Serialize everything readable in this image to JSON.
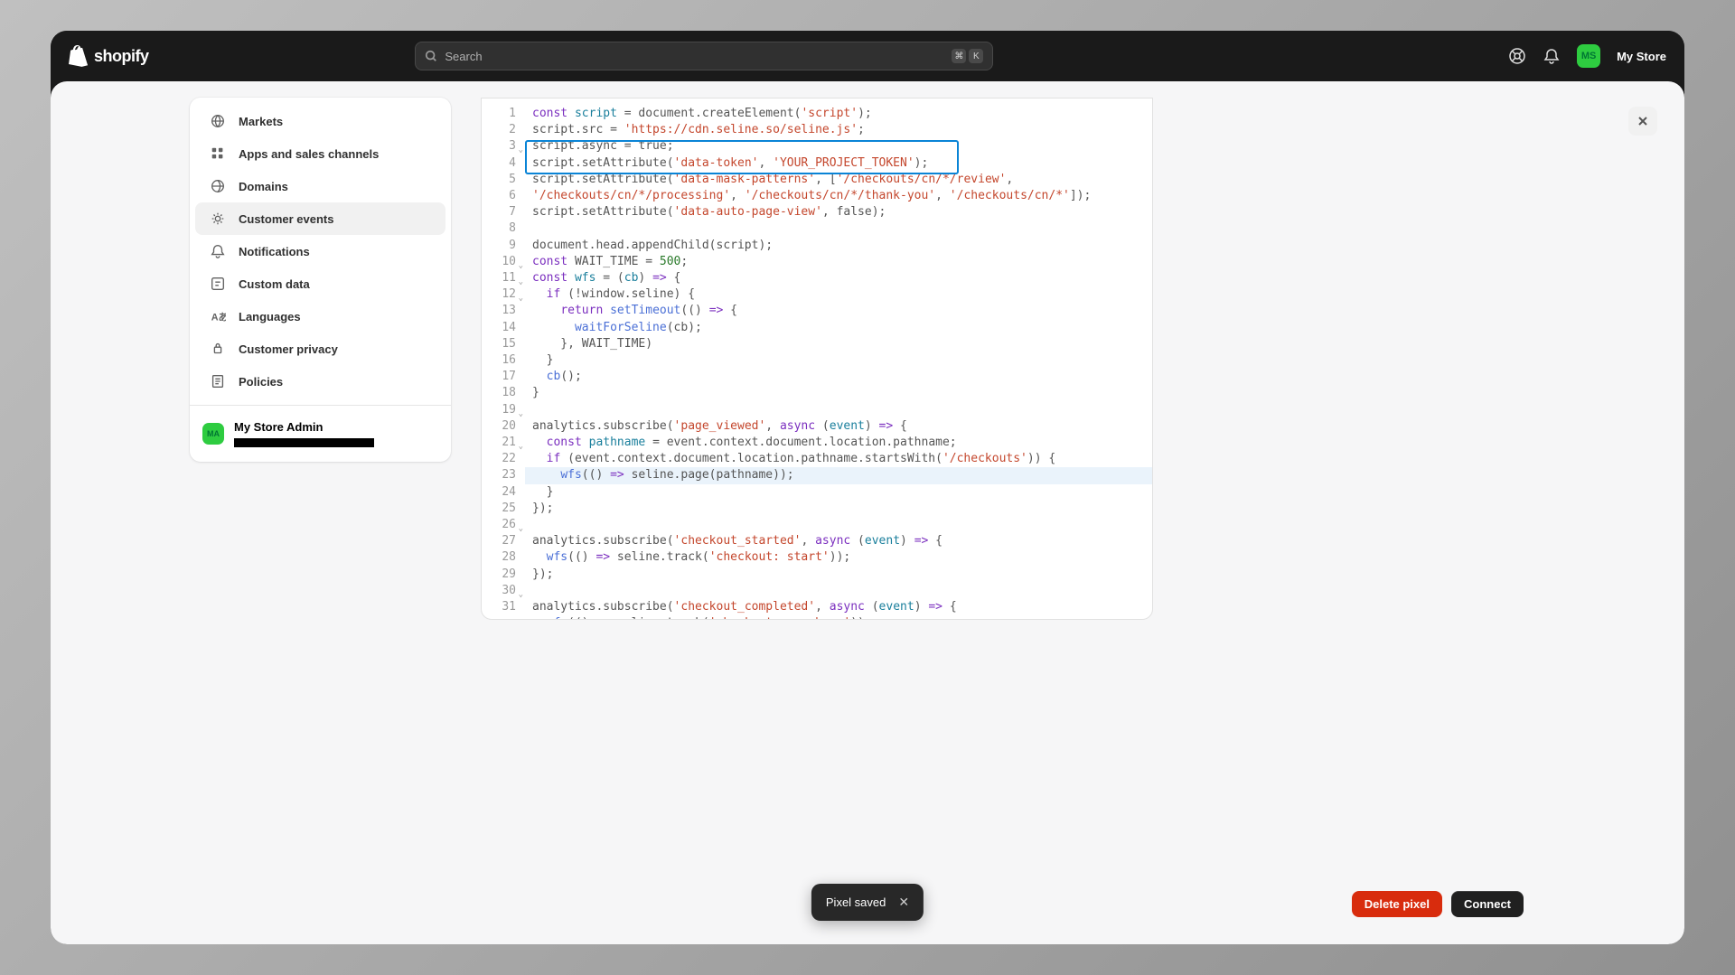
{
  "header": {
    "brand": "shopify",
    "search_placeholder": "Search",
    "kbd1": "⌘",
    "kbd2": "K",
    "avatar_initials": "MS",
    "store_name": "My Store"
  },
  "sidebar": {
    "items": [
      {
        "label": "Markets"
      },
      {
        "label": "Apps and sales channels"
      },
      {
        "label": "Domains"
      },
      {
        "label": "Customer events",
        "active": true
      },
      {
        "label": "Notifications"
      },
      {
        "label": "Custom data"
      },
      {
        "label": "Languages"
      },
      {
        "label": "Customer privacy"
      },
      {
        "label": "Policies"
      }
    ],
    "admin": {
      "avatar": "MA",
      "name": "My Store Admin"
    }
  },
  "code": {
    "lines": [
      {
        "n": 1,
        "spans": [
          [
            "kw",
            "const"
          ],
          [
            "pu",
            " "
          ],
          [
            "var",
            "script"
          ],
          [
            "pu",
            " = document.createElement("
          ],
          [
            "str",
            "'script'"
          ],
          [
            "pu",
            ");"
          ]
        ]
      },
      {
        "n": 2,
        "spans": [
          [
            "pu",
            "script.src = "
          ],
          [
            "str",
            "'https://cdn.seline.so/seline.js'"
          ],
          [
            "pu",
            ";"
          ]
        ]
      },
      {
        "n": 3,
        "fold": true,
        "spans": [
          [
            "pu",
            "script.async = true;"
          ]
        ]
      },
      {
        "n": 4,
        "spans": [
          [
            "pu",
            "script.setAttribute("
          ],
          [
            "str",
            "'data-token'"
          ],
          [
            "pu",
            ", "
          ],
          [
            "str",
            "'YOUR_PROJECT_TOKEN'"
          ],
          [
            "pu",
            ");"
          ]
        ]
      },
      {
        "n": 5,
        "spans": [
          [
            "pu",
            "script.setAttribute("
          ],
          [
            "str",
            "'data-mask-patterns'"
          ],
          [
            "pu",
            ", ["
          ],
          [
            "str",
            "'/checkouts/cn/*/review'"
          ],
          [
            "pu",
            ", "
          ]
        ]
      },
      {
        "n": "",
        "spans": [
          [
            "str",
            "'/checkouts/cn/*/processing'"
          ],
          [
            "pu",
            ", "
          ],
          [
            "str",
            "'/checkouts/cn/*/thank-you'"
          ],
          [
            "pu",
            ", "
          ],
          [
            "str",
            "'/checkouts/cn/*'"
          ],
          [
            "pu",
            "]);"
          ]
        ]
      },
      {
        "n": 6,
        "spans": [
          [
            "pu",
            "script.setAttribute("
          ],
          [
            "str",
            "'data-auto-page-view'"
          ],
          [
            "pu",
            ", false);"
          ]
        ]
      },
      {
        "n": 7,
        "spans": [
          [
            "pu",
            ""
          ]
        ]
      },
      {
        "n": 8,
        "spans": [
          [
            "pu",
            "document.head.appendChild(script);"
          ]
        ]
      },
      {
        "n": 9,
        "spans": [
          [
            "kw",
            "const"
          ],
          [
            "pu",
            " WAIT_TIME = "
          ],
          [
            "num",
            "500"
          ],
          [
            "pu",
            ";"
          ]
        ]
      },
      {
        "n": 10,
        "fold": true,
        "spans": [
          [
            "kw",
            "const"
          ],
          [
            "pu",
            " "
          ],
          [
            "var",
            "wfs"
          ],
          [
            "pu",
            " = ("
          ],
          [
            "var",
            "cb"
          ],
          [
            "pu",
            ") "
          ],
          [
            "kw",
            "=>"
          ],
          [
            "pu",
            " {"
          ]
        ]
      },
      {
        "n": 11,
        "fold": true,
        "spans": [
          [
            "pu",
            "  "
          ],
          [
            "kw",
            "if"
          ],
          [
            "pu",
            " (!window.seline) {"
          ]
        ]
      },
      {
        "n": 12,
        "fold": true,
        "spans": [
          [
            "pu",
            "    "
          ],
          [
            "kw",
            "return"
          ],
          [
            "pu",
            " "
          ],
          [
            "fn",
            "setTimeout"
          ],
          [
            "pu",
            "(() "
          ],
          [
            "kw",
            "=>"
          ],
          [
            "pu",
            " {"
          ]
        ]
      },
      {
        "n": 13,
        "spans": [
          [
            "pu",
            "      "
          ],
          [
            "fn",
            "waitForSeline"
          ],
          [
            "pu",
            "(cb);"
          ]
        ]
      },
      {
        "n": 14,
        "spans": [
          [
            "pu",
            "    }, WAIT_TIME)"
          ]
        ]
      },
      {
        "n": 15,
        "spans": [
          [
            "pu",
            "  }"
          ]
        ]
      },
      {
        "n": 16,
        "spans": [
          [
            "pu",
            "  "
          ],
          [
            "fn",
            "cb"
          ],
          [
            "pu",
            "();"
          ]
        ]
      },
      {
        "n": 17,
        "spans": [
          [
            "pu",
            "}"
          ]
        ]
      },
      {
        "n": 18,
        "spans": [
          [
            "pu",
            ""
          ]
        ]
      },
      {
        "n": 19,
        "fold": true,
        "spans": [
          [
            "pu",
            "analytics.subscribe("
          ],
          [
            "str",
            "'page_viewed'"
          ],
          [
            "pu",
            ", "
          ],
          [
            "kw",
            "async"
          ],
          [
            "pu",
            " ("
          ],
          [
            "var",
            "event"
          ],
          [
            "pu",
            ") "
          ],
          [
            "kw",
            "=>"
          ],
          [
            "pu",
            " {"
          ]
        ]
      },
      {
        "n": 20,
        "spans": [
          [
            "pu",
            "  "
          ],
          [
            "kw",
            "const"
          ],
          [
            "pu",
            " "
          ],
          [
            "var",
            "pathname"
          ],
          [
            "pu",
            " = event.context.document.location.pathname;"
          ]
        ]
      },
      {
        "n": 21,
        "fold": true,
        "spans": [
          [
            "pu",
            "  "
          ],
          [
            "kw",
            "if"
          ],
          [
            "pu",
            " (event.context.document.location.pathname.startsWith("
          ],
          [
            "str",
            "'/checkouts'"
          ],
          [
            "pu",
            ")) {"
          ]
        ]
      },
      {
        "n": 22,
        "hl": true,
        "spans": [
          [
            "pu",
            "    "
          ],
          [
            "fn",
            "wfs"
          ],
          [
            "pu",
            "(() "
          ],
          [
            "kw",
            "=>"
          ],
          [
            "pu",
            " seline.page(pathname));"
          ]
        ]
      },
      {
        "n": 23,
        "spans": [
          [
            "pu",
            "  }"
          ]
        ]
      },
      {
        "n": 24,
        "spans": [
          [
            "pu",
            "});"
          ]
        ]
      },
      {
        "n": 25,
        "spans": [
          [
            "pu",
            ""
          ]
        ]
      },
      {
        "n": 26,
        "fold": true,
        "spans": [
          [
            "pu",
            "analytics.subscribe("
          ],
          [
            "str",
            "'checkout_started'"
          ],
          [
            "pu",
            ", "
          ],
          [
            "kw",
            "async"
          ],
          [
            "pu",
            " ("
          ],
          [
            "var",
            "event"
          ],
          [
            "pu",
            ") "
          ],
          [
            "kw",
            "=>"
          ],
          [
            "pu",
            " {"
          ]
        ]
      },
      {
        "n": 27,
        "spans": [
          [
            "pu",
            "  "
          ],
          [
            "fn",
            "wfs"
          ],
          [
            "pu",
            "(() "
          ],
          [
            "kw",
            "=>"
          ],
          [
            "pu",
            " seline.track("
          ],
          [
            "str",
            "'checkout: start'"
          ],
          [
            "pu",
            "));"
          ]
        ]
      },
      {
        "n": 28,
        "spans": [
          [
            "pu",
            "});"
          ]
        ]
      },
      {
        "n": 29,
        "spans": [
          [
            "pu",
            ""
          ]
        ]
      },
      {
        "n": 30,
        "fold": true,
        "spans": [
          [
            "pu",
            "analytics.subscribe("
          ],
          [
            "str",
            "'checkout_completed'"
          ],
          [
            "pu",
            ", "
          ],
          [
            "kw",
            "async"
          ],
          [
            "pu",
            " ("
          ],
          [
            "var",
            "event"
          ],
          [
            "pu",
            ") "
          ],
          [
            "kw",
            "=>"
          ],
          [
            "pu",
            " {"
          ]
        ]
      },
      {
        "n": 31,
        "spans": [
          [
            "pu",
            "  "
          ],
          [
            "fn",
            "wfs"
          ],
          [
            "pu",
            "(() "
          ],
          [
            "kw",
            "=>"
          ],
          [
            "pu",
            " seline.track("
          ],
          [
            "str",
            "'checkout: purchase'"
          ],
          [
            "pu",
            "));"
          ]
        ]
      }
    ]
  },
  "footer": {
    "delete": "Delete pixel",
    "connect": "Connect"
  },
  "toast": {
    "message": "Pixel saved"
  }
}
